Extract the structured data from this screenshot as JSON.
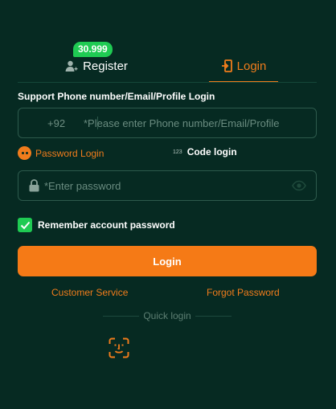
{
  "tabs": {
    "register_label": "Register",
    "register_badge": "30.999",
    "login_label": "Login",
    "active": "login"
  },
  "form": {
    "phone_section_label": "Support Phone number/Email/Profile Login",
    "country_code": "+92",
    "phone_placeholder": "*Please enter Phone number/Email/Profile",
    "password_login_label": "Password Login",
    "code_login_prefix": "123",
    "code_login_label": "Code login",
    "password_placeholder": "*Enter password",
    "remember_label": "Remember account password",
    "remember_checked": true,
    "login_button": "Login"
  },
  "links": {
    "customer_service": "Customer Service",
    "forgot_password": "Forgot Password"
  },
  "quick_login": {
    "label": "Quick login",
    "icon": "face-id-icon"
  },
  "colors": {
    "background": "#062a22",
    "accent": "#f07c1c",
    "badge": "#1fcb53"
  }
}
